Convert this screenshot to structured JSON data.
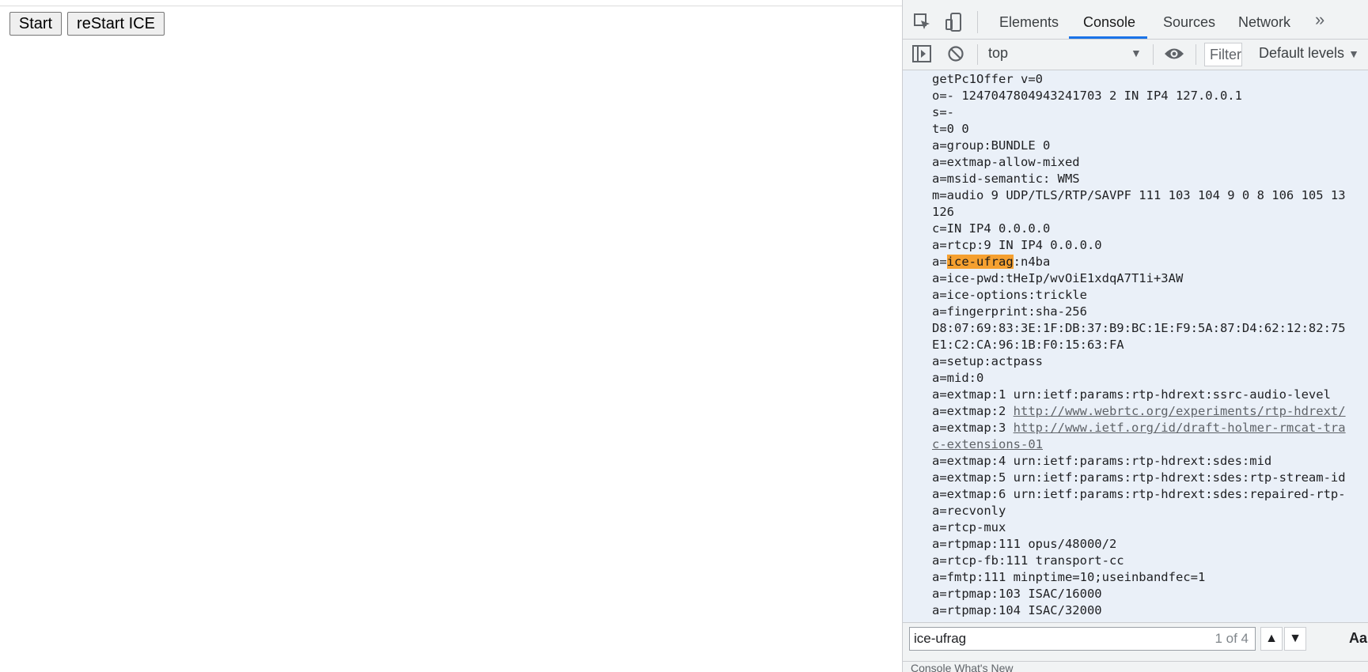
{
  "page": {
    "buttons": {
      "start": "Start",
      "restart_ice": "reStart ICE"
    }
  },
  "devtools": {
    "tabs": [
      "Elements",
      "Console",
      "Sources",
      "Network"
    ],
    "active_tab": "Console",
    "more_tabs_glyph": "»",
    "toolbar": {
      "context": "top",
      "filter_placeholder": "Filter",
      "levels": "Default levels"
    },
    "console_lines": [
      "getPc1Offer v=0",
      "o=- 1247047804943241703 2 IN IP4 127.0.0.1",
      "s=-",
      "t=0 0",
      "a=group:BUNDLE 0",
      "a=extmap-allow-mixed",
      "a=msid-semantic: WMS",
      "m=audio 9 UDP/TLS/RTP/SAVPF 111 103 104 9 0 8 106 105 13",
      "126",
      "c=IN IP4 0.0.0.0",
      "a=rtcp:9 IN IP4 0.0.0.0",
      "a=ice-ufrag:n4ba",
      "a=ice-pwd:tHeIp/wvOiE1xdqA7T1i+3AW",
      "a=ice-options:trickle",
      "a=fingerprint:sha-256",
      "D8:07:69:83:3E:1F:DB:37:B9:BC:1E:F9:5A:87:D4:62:12:82:75",
      "E1:C2:CA:96:1B:F0:15:63:FA",
      "a=setup:actpass",
      "a=mid:0",
      "a=extmap:1 urn:ietf:params:rtp-hdrext:ssrc-audio-level",
      "a=extmap:2 http://www.webrtc.org/experiments/rtp-hdrext/",
      "a=extmap:3 http://www.ietf.org/id/draft-holmer-rmcat-tra",
      "c-extensions-01",
      "a=extmap:4 urn:ietf:params:rtp-hdrext:sdes:mid",
      "a=extmap:5 urn:ietf:params:rtp-hdrext:sdes:rtp-stream-id",
      "a=extmap:6 urn:ietf:params:rtp-hdrext:sdes:repaired-rtp-",
      "a=recvonly",
      "a=rtcp-mux",
      "a=rtpmap:111 opus/48000/2",
      "a=rtcp-fb:111 transport-cc",
      "a=fmtp:111 minptime=10;useinbandfec=1",
      "a=rtpmap:103 ISAC/16000",
      "a=rtpmap:104 ISAC/32000"
    ],
    "highlight_term": "ice-ufrag",
    "search": {
      "value": "ice-ufrag",
      "match_count": "1 of 4",
      "prev": "▲",
      "next": "▼",
      "match_case": "Aa"
    },
    "drawer_text": "Console   What's New"
  }
}
